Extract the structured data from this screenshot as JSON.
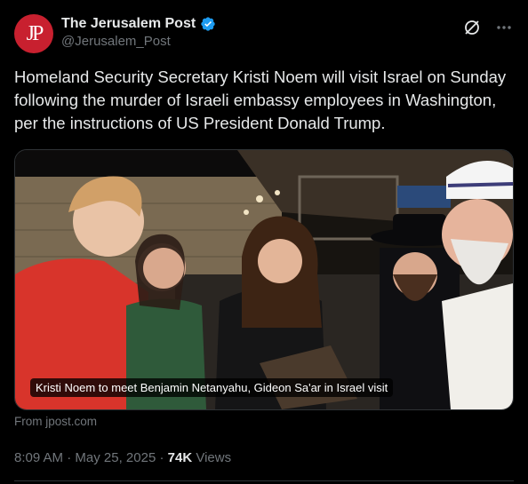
{
  "account": {
    "display_name": "The Jerusalem Post",
    "handle": "@Jerusalem_Post",
    "avatar_text": "JP",
    "avatar_color": "#c8202f",
    "verified_icon": "verified-badge-icon",
    "verified_color": "#1d9bf0"
  },
  "header_actions": [
    "grok-icon",
    "more-icon"
  ],
  "tweet": {
    "text": "Homeland Security Secretary Kristi Noem will visit Israel on Sunday following the murder of Israeli embassy employees in Washington, per the instructions of US President Donald Trump."
  },
  "media": {
    "caption": "Kristi Noem to meet Benjamin Netanyahu, Gideon Sa'ar in Israel visit"
  },
  "link_source": "From jpost.com",
  "meta": {
    "time": "8:09 AM",
    "separator": "·",
    "date": "May 25, 2025",
    "views_count": "74K",
    "views_label": "Views"
  },
  "colors": {
    "background": "#000000",
    "primary_text": "#e7e9ea",
    "secondary_text": "#71767b",
    "border": "#2f3336"
  }
}
